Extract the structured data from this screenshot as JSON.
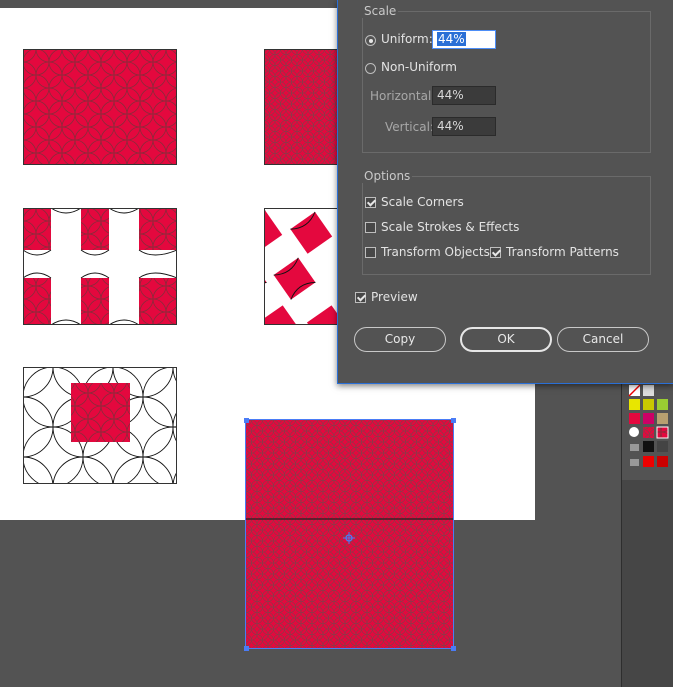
{
  "dialog": {
    "scale_group_title": "Scale",
    "uniform_label": "Uniform:",
    "uniform_value": "44%",
    "non_uniform_label": "Non-Uniform",
    "horizontal_label": "Horizontal:",
    "horizontal_value": "44%",
    "vertical_label": "Vertical:",
    "vertical_value": "44%",
    "options_group_title": "Options",
    "scale_corners_label": "Scale Corners",
    "scale_strokes_label": "Scale Strokes & Effects",
    "transform_objects_label": "Transform Objects",
    "transform_patterns_label": "Transform Patterns",
    "preview_label": "Preview",
    "copy_label": "Copy",
    "ok_label": "OK",
    "cancel_label": "Cancel",
    "state": {
      "uniform_selected": true,
      "scale_corners": true,
      "scale_strokes": false,
      "transform_objects": false,
      "transform_patterns": true,
      "preview": true
    }
  },
  "colors": {
    "pattern_red": "#e4083e",
    "selection_blue": "#4a7cf6",
    "workspace": "#535353"
  },
  "icons": {
    "center_point": "crosshair-icon",
    "radio": "radio-icon",
    "checkbox": "checkbox-icon"
  }
}
